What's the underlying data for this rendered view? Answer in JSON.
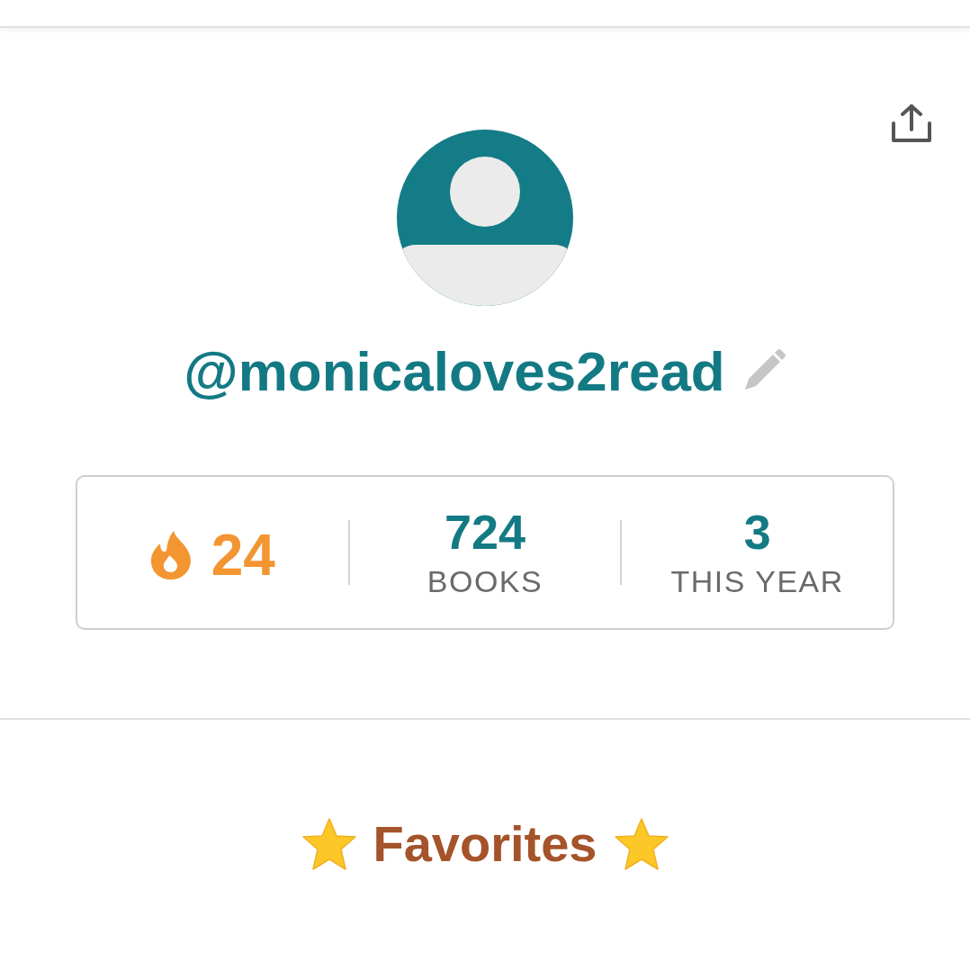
{
  "profile": {
    "username": "@monicaloves2read"
  },
  "stats": [
    {
      "kind": "streak",
      "value": "24"
    },
    {
      "kind": "count",
      "value": "724",
      "label": "BOOKS"
    },
    {
      "kind": "count",
      "value": "3",
      "label": "THIS YEAR"
    }
  ],
  "favorites": {
    "title": "Favorites"
  }
}
